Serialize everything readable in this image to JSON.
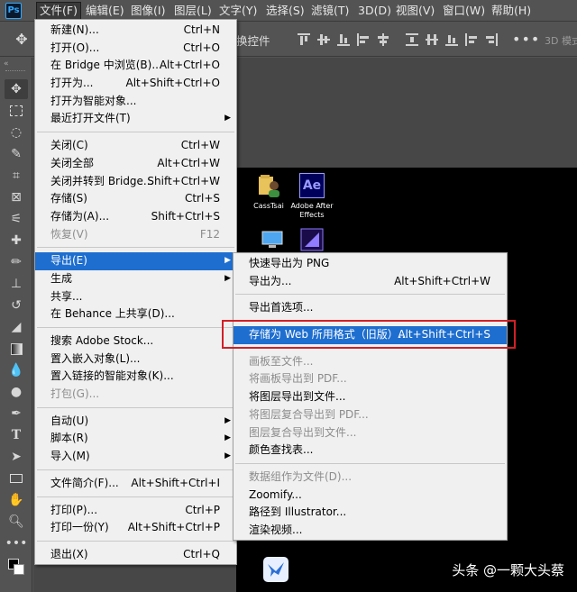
{
  "app": {
    "logo": "Ps"
  },
  "menubar": {
    "items": [
      "文件(F)",
      "编辑(E)",
      "图像(I)",
      "图层(L)",
      "文字(Y)",
      "选择(S)",
      "滤镜(T)",
      "3D(D)",
      "视图(V)",
      "窗口(W)",
      "帮助(H)"
    ],
    "active_index": 0
  },
  "options_bar": {
    "label_fragment": "换控件",
    "more": "•••",
    "mode_3d": "3D 模式"
  },
  "file_menu": {
    "groups": [
      [
        {
          "label": "新建(N)...",
          "shortcut": "Ctrl+N"
        },
        {
          "label": "打开(O)...",
          "shortcut": "Ctrl+O"
        },
        {
          "label": "在 Bridge 中浏览(B)...",
          "shortcut": "Alt+Ctrl+O"
        },
        {
          "label": "打开为...",
          "shortcut": "Alt+Shift+Ctrl+O"
        },
        {
          "label": "打开为智能对象..."
        },
        {
          "label": "最近打开文件(T)",
          "submenu": true
        }
      ],
      [
        {
          "label": "关闭(C)",
          "shortcut": "Ctrl+W"
        },
        {
          "label": "关闭全部",
          "shortcut": "Alt+Ctrl+W"
        },
        {
          "label": "关闭并转到 Bridge...",
          "shortcut": "Shift+Ctrl+W"
        },
        {
          "label": "存储(S)",
          "shortcut": "Ctrl+S"
        },
        {
          "label": "存储为(A)...",
          "shortcut": "Shift+Ctrl+S"
        },
        {
          "label": "恢复(V)",
          "shortcut": "F12",
          "disabled": true
        }
      ],
      [
        {
          "label": "导出(E)",
          "submenu": true,
          "highlighted": true
        },
        {
          "label": "生成",
          "submenu": true
        },
        {
          "label": "共享..."
        },
        {
          "label": "在 Behance 上共享(D)..."
        }
      ],
      [
        {
          "label": "搜索 Adobe Stock..."
        },
        {
          "label": "置入嵌入对象(L)..."
        },
        {
          "label": "置入链接的智能对象(K)..."
        },
        {
          "label": "打包(G)...",
          "disabled": true
        }
      ],
      [
        {
          "label": "自动(U)",
          "submenu": true
        },
        {
          "label": "脚本(R)",
          "submenu": true
        },
        {
          "label": "导入(M)",
          "submenu": true
        }
      ],
      [
        {
          "label": "文件简介(F)...",
          "shortcut": "Alt+Shift+Ctrl+I"
        }
      ],
      [
        {
          "label": "打印(P)...",
          "shortcut": "Ctrl+P"
        },
        {
          "label": "打印一份(Y)",
          "shortcut": "Alt+Shift+Ctrl+P"
        }
      ],
      [
        {
          "label": "退出(X)",
          "shortcut": "Ctrl+Q"
        }
      ]
    ]
  },
  "export_menu": {
    "groups": [
      [
        {
          "label": "快速导出为 PNG"
        },
        {
          "label": "导出为...",
          "shortcut": "Alt+Shift+Ctrl+W"
        }
      ],
      [
        {
          "label": "导出首选项..."
        }
      ],
      [
        {
          "label": "存储为 Web 所用格式（旧版）...",
          "shortcut": "Alt+Shift+Ctrl+S",
          "highlighted": true
        }
      ],
      [
        {
          "label": "画板至文件...",
          "disabled": true
        },
        {
          "label": "将画板导出到 PDF...",
          "disabled": true
        },
        {
          "label": "将图层导出到文件..."
        },
        {
          "label": "将图层复合导出到 PDF...",
          "disabled": true
        },
        {
          "label": "图层复合导出到文件...",
          "disabled": true
        },
        {
          "label": "颜色查找表..."
        }
      ],
      [
        {
          "label": "数据组作为文件(D)...",
          "disabled": true
        },
        {
          "label": "Zoomify..."
        },
        {
          "label": "路径到 Illustrator..."
        },
        {
          "label": "渲染视频..."
        }
      ]
    ]
  },
  "desktop_icons": [
    {
      "label": "CassTsai",
      "icon": "user-folder-icon"
    },
    {
      "label": "Adobe After Effects",
      "icon": "after-effects-icon",
      "glyph": "Ae"
    }
  ],
  "watermark": "头条 @一颗大头蔡",
  "colors": {
    "menu_highlight": "#1e6ecf",
    "annotation_box": "#d21f26",
    "ps_blue": "#31a8ff",
    "ae_purple": "#9999ff"
  }
}
